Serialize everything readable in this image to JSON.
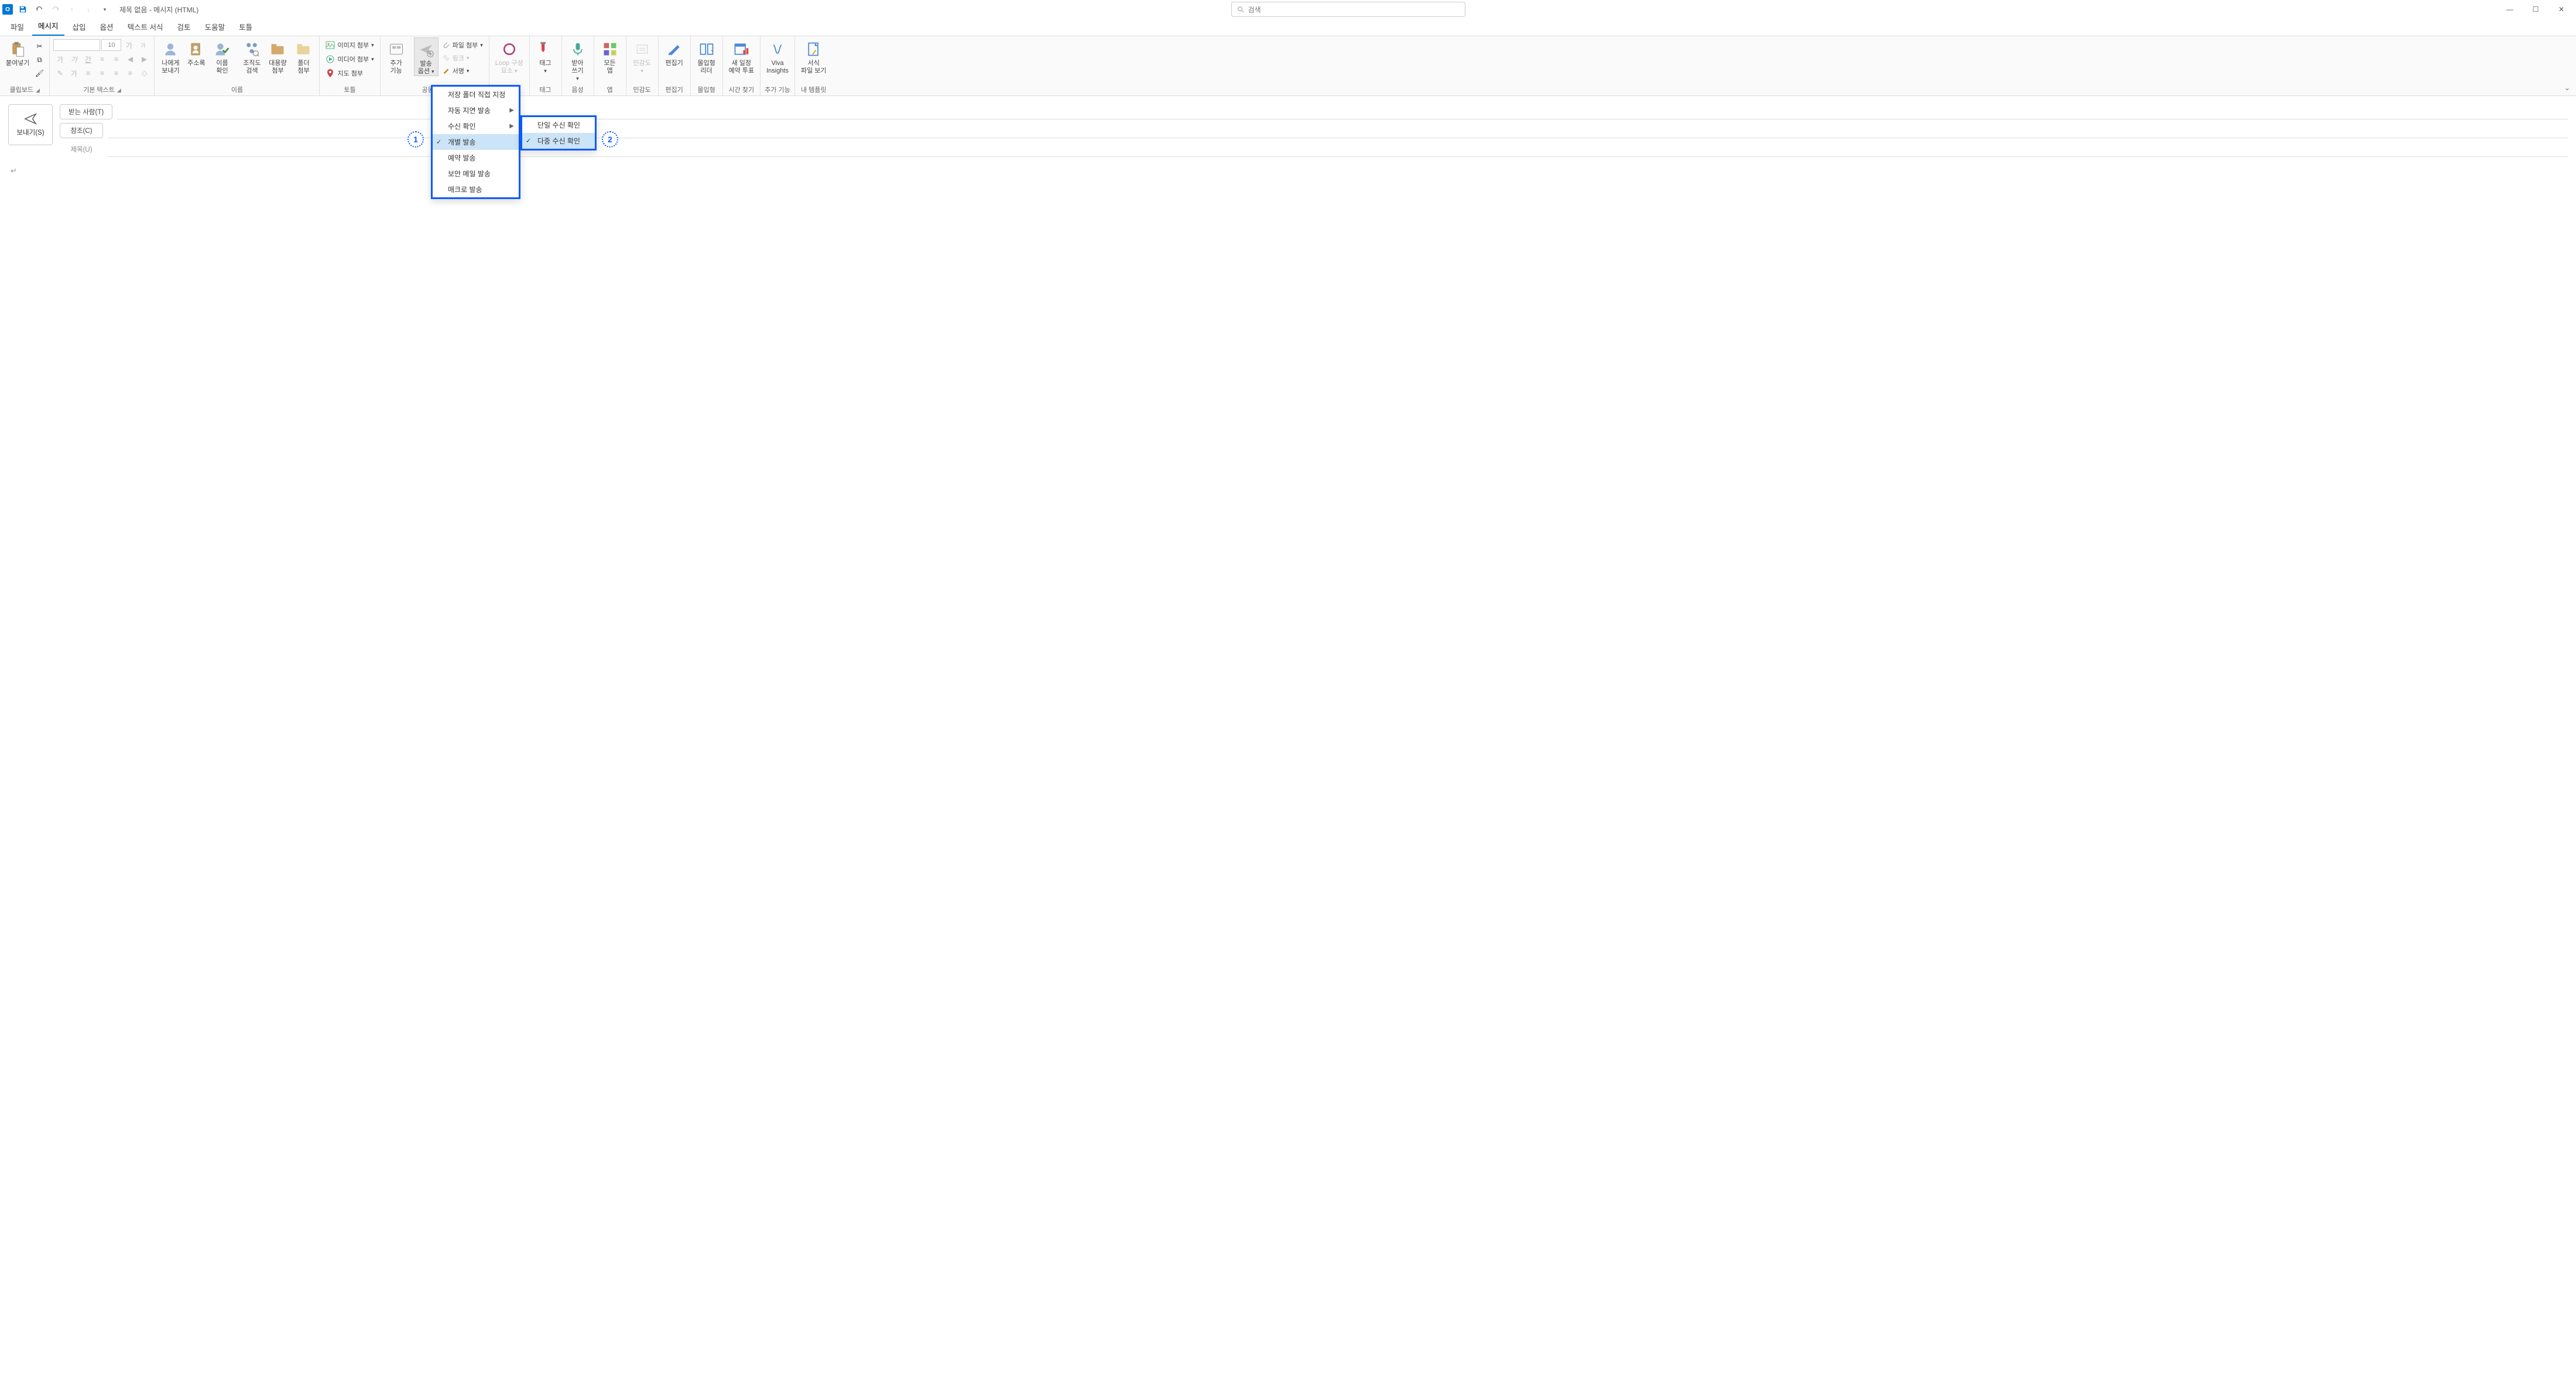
{
  "title": "제목 없음 - 메시지 (HTML)",
  "search_placeholder": "검색",
  "tabs": [
    "파일",
    "메시지",
    "삽입",
    "옵션",
    "텍스트 서식",
    "검토",
    "도움말",
    "토틀"
  ],
  "ribbon": {
    "clipboard": {
      "label": "클립보드",
      "paste": "붙여넣기"
    },
    "basicText": {
      "label": "기본 텍스트",
      "fontSize": "10"
    },
    "names": {
      "label": "이름",
      "sendToMe": "나에게\n보내기",
      "addressBook": "주소록",
      "checkNames": "이름\n확인",
      "orgSearch": "조직도\n검색",
      "bulkAttach": "대용량\n첨부",
      "folderAttach": "폴더\n첨부"
    },
    "tottle": {
      "label": "토틀",
      "imageAttach": "이미지 첨부",
      "mediaAttach": "미디어 첨부",
      "mapAttach": "지도 첨부"
    },
    "addons": {
      "add": "추가\n기능",
      "sendOptions": "발송\n옵션",
      "fileAttach": "파일 첨부",
      "link": "링크",
      "signature": "서명"
    },
    "collab": {
      "label": "공동 작업",
      "loop": "Loop 구성\n요소"
    },
    "tag": {
      "label": "태그",
      "tag": "태그"
    },
    "voice": {
      "label": "음성",
      "dictate": "받아\n쓰기"
    },
    "apps": {
      "label": "앱",
      "allApps": "모든\n앱"
    },
    "sensitivity": {
      "label": "민감도",
      "sensitivity": "민감도"
    },
    "editor": {
      "label": "편집기",
      "editor": "편집기"
    },
    "immersive": {
      "label": "몰입형",
      "reader": "몰입형\n리더"
    },
    "findTime": {
      "label": "시간 찾기",
      "poll": "새 일정\n예약 투표"
    },
    "extra": {
      "label": "추가 기능",
      "viva": "Viva\nInsights"
    },
    "template": {
      "label": "내 템플릿",
      "view": "서식\n파일 보기"
    }
  },
  "compose": {
    "send": "보내기(S)",
    "to": "받는 사람(T)",
    "cc": "참조(C)",
    "subject": "제목(U)"
  },
  "menu1": {
    "items": [
      "저장 폴더 직접 지정",
      "자동 지연 발송",
      "수신 확인",
      "개별 발송",
      "예약 발송",
      "보안 메일 발송",
      "매크로 발송"
    ]
  },
  "menu2": {
    "items": [
      "단일 수신 확인",
      "다중 수신 확인"
    ]
  },
  "callouts": {
    "one": "1",
    "two": "2"
  }
}
